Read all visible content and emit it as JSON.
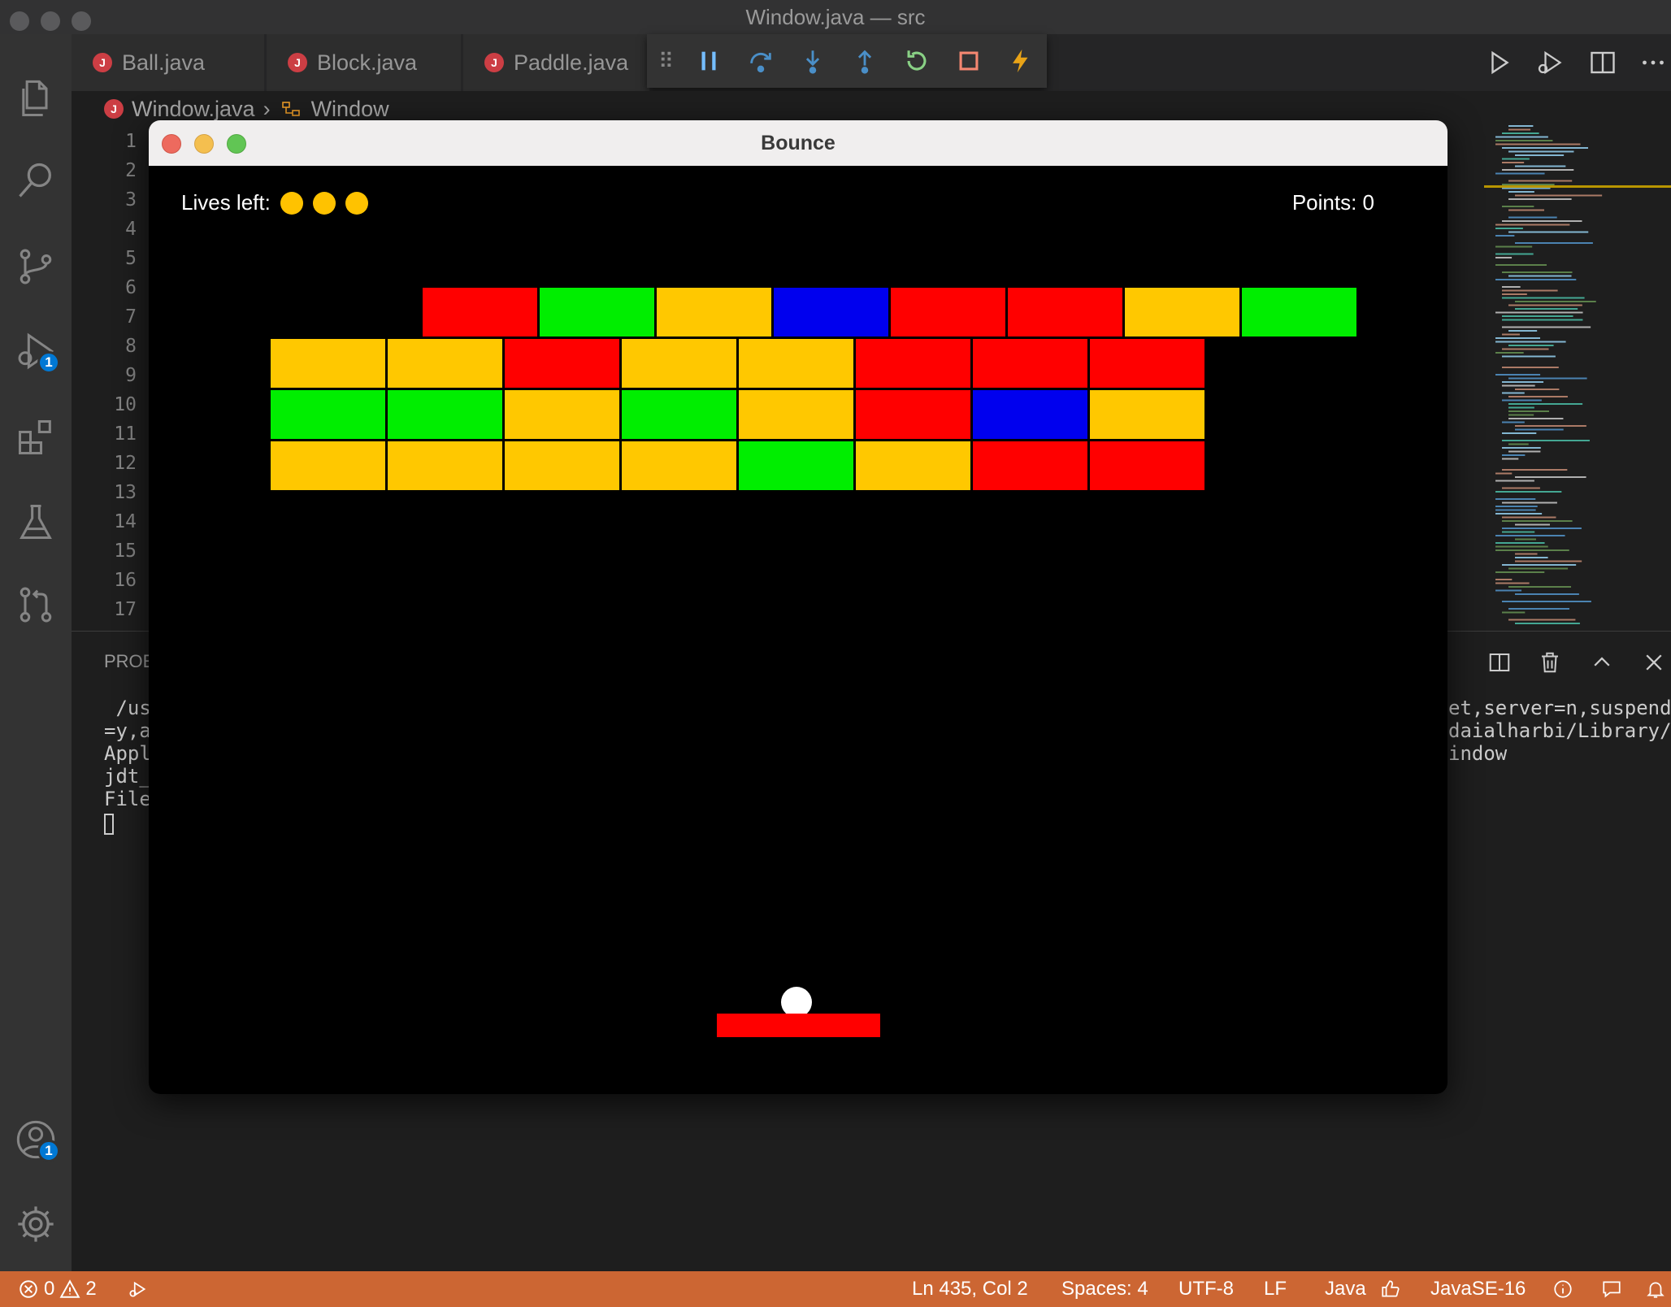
{
  "window": {
    "title": "Window.java — src"
  },
  "tabs": [
    {
      "label": "Ball.java"
    },
    {
      "label": "Block.java"
    },
    {
      "label": "Paddle.java"
    }
  ],
  "debug_toolbar": [
    "pause",
    "step-over",
    "step-into",
    "step-out",
    "restart",
    "stop",
    "hot-code-replace"
  ],
  "breadcrumb": {
    "file": "Window.java",
    "symbol": "Window"
  },
  "editor": {
    "line_numbers": [
      "1",
      "2",
      "3",
      "4",
      "5",
      "6",
      "7",
      "8",
      "9",
      "10",
      "11",
      "12",
      "13",
      "14",
      "15",
      "16",
      "17"
    ]
  },
  "activity_bar": {
    "run_badge": "1",
    "accounts_badge": "1"
  },
  "panel": {
    "tab": "PROE",
    "terminal_left": [
      " /us",
      "=y,a",
      "Appl",
      "jdt_",
      "File"
    ],
    "terminal_right": [
      "et,server=n,suspend",
      "daialharbi/Library/",
      "indow"
    ]
  },
  "bounce": {
    "title": "Bounce",
    "lives_label": "Lives left:",
    "lives": 3,
    "points_label": "Points: 0",
    "brick_colors": {
      "red": "#ff0000",
      "green": "#00ee00",
      "yellow": "#ffc800",
      "blue": "#0000ee"
    },
    "rows": [
      {
        "offset": 2.3,
        "bricks": [
          "red",
          "green",
          "yellow",
          "blue",
          "red",
          "red",
          "yellow",
          "green"
        ]
      },
      {
        "offset": 1.0,
        "bricks": [
          "yellow",
          "yellow",
          "red",
          "yellow",
          "yellow",
          "red",
          "red",
          "red"
        ]
      },
      {
        "offset": 1.0,
        "bricks": [
          "green",
          "green",
          "yellow",
          "green",
          "yellow",
          "red",
          "blue",
          "yellow"
        ]
      },
      {
        "offset": 1.0,
        "bricks": [
          "yellow",
          "yellow",
          "yellow",
          "yellow",
          "green",
          "yellow",
          "red",
          "red"
        ]
      }
    ]
  },
  "status_bar": {
    "errors": "0",
    "warnings": "2",
    "position": "Ln 435, Col 2",
    "spaces": "Spaces: 4",
    "encoding": "UTF-8",
    "eol": "LF",
    "language": "Java",
    "runtime": "JavaSE-16"
  },
  "colors": {
    "accent_status": "#cc6633",
    "badge": "#0078d4",
    "java_icon": "#cc3e44"
  }
}
